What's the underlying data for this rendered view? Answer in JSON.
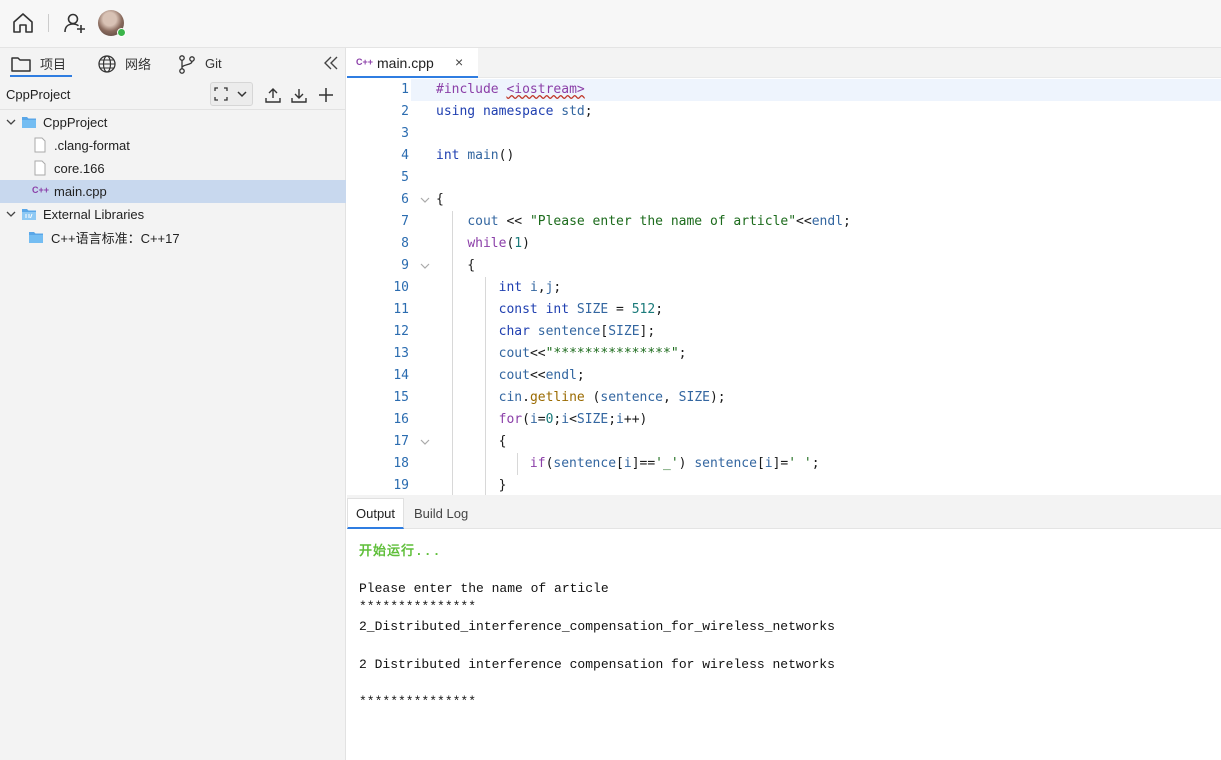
{
  "toolbar": {
    "home_icon": "home-icon",
    "add_user_icon": "add-user-icon",
    "avatar_status_color": "#3bb54a"
  },
  "sidebar": {
    "tabs": [
      {
        "label": "项目",
        "icon": "folder-icon",
        "active": true
      },
      {
        "label": "网络",
        "icon": "globe-icon",
        "active": false
      },
      {
        "label": "Git",
        "icon": "git-branch-icon",
        "active": false
      }
    ],
    "project_label": "CppProject",
    "tree": [
      {
        "label": "CppProject",
        "type": "folder",
        "expanded": true
      },
      {
        "label": ".clang-format",
        "type": "file"
      },
      {
        "label": "core.166",
        "type": "file"
      },
      {
        "label": "main.cpp",
        "type": "cpp",
        "selected": true
      },
      {
        "label": "External Libraries",
        "type": "library",
        "expanded": true
      },
      {
        "label": "C++语言标准：C++17",
        "type": "folder"
      }
    ]
  },
  "editor": {
    "tab": {
      "icon": "C++",
      "label": "main.cpp",
      "close": "×"
    },
    "line_numbers": [
      "1",
      "2",
      "3",
      "4",
      "5",
      "6",
      "7",
      "8",
      "9",
      "10",
      "11",
      "12",
      "13",
      "14",
      "15",
      "16",
      "17",
      "18",
      "19"
    ]
  },
  "output": {
    "tabs": [
      "Output",
      "Build Log"
    ],
    "start_text": "开始运行...",
    "lines": [
      "Please enter the name of article",
      "***************",
      "2_Distributed_interference_compensation_for_wireless_networks",
      "",
      "2 Distributed interference compensation for wireless networks",
      "",
      "***************"
    ]
  },
  "colors": {
    "accent": "#2f7de1",
    "keyword": "#1f3fb0",
    "string": "#1c6b1c",
    "number": "#1a7a7a",
    "start_green": "#5fbf3a"
  }
}
